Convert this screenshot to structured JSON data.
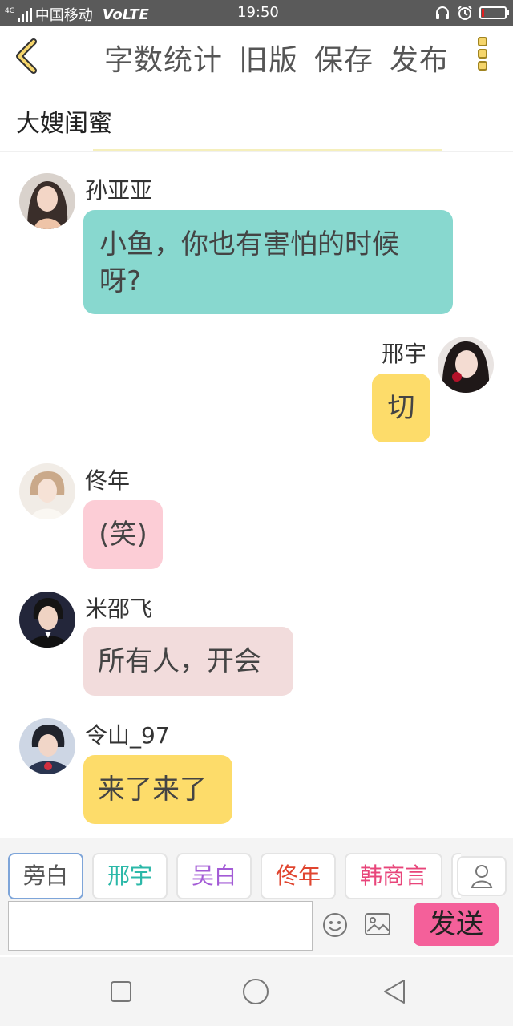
{
  "status": {
    "network": "4G",
    "carrier": "中国移动",
    "volte": "VoLTE",
    "time": "19:50",
    "battery_level": 0.1
  },
  "toolbar": {
    "back_icon": "chevron-left-icon",
    "word_count": "字数统计",
    "old_version": "旧版",
    "save": "保存",
    "publish": "发布",
    "more_icon": "more-vertical-icon"
  },
  "story_title": "大嫂闺蜜",
  "messages": [
    {
      "name": "孙亚亚",
      "text": "小鱼，你也有害怕的时候呀?",
      "side": "left",
      "bubble_color": "#88d8cf"
    },
    {
      "name": "邢宇",
      "text": "切",
      "side": "right",
      "bubble_color": "#fddc6a"
    },
    {
      "name": "佟年",
      "text": "(笑)",
      "side": "left",
      "bubble_color": "#fccdd6"
    },
    {
      "name": "米邵飞",
      "text": "所有人，开会",
      "side": "left",
      "bubble_color": "#f2dcdc"
    },
    {
      "name": "令山_97",
      "text": "来了来了",
      "side": "left",
      "bubble_color": "#fddc6a"
    }
  ],
  "characters": [
    {
      "name": "旁白",
      "color": "#555555",
      "selected": true
    },
    {
      "name": "邢宇",
      "color": "#2bb8a8",
      "selected": false
    },
    {
      "name": "吴白",
      "color": "#a35bd6",
      "selected": false
    },
    {
      "name": "佟年",
      "color": "#e0452f",
      "selected": false
    },
    {
      "name": "韩商言",
      "color": "#e8457a",
      "selected": false
    }
  ],
  "input": {
    "placeholder": "",
    "send_label": "发送"
  },
  "icons": {
    "add_character": "person-icon",
    "emoji": "emoji-icon",
    "image": "image-icon"
  },
  "nav": {
    "recent": "square-icon",
    "home": "circle-icon",
    "back": "triangle-back-icon"
  }
}
